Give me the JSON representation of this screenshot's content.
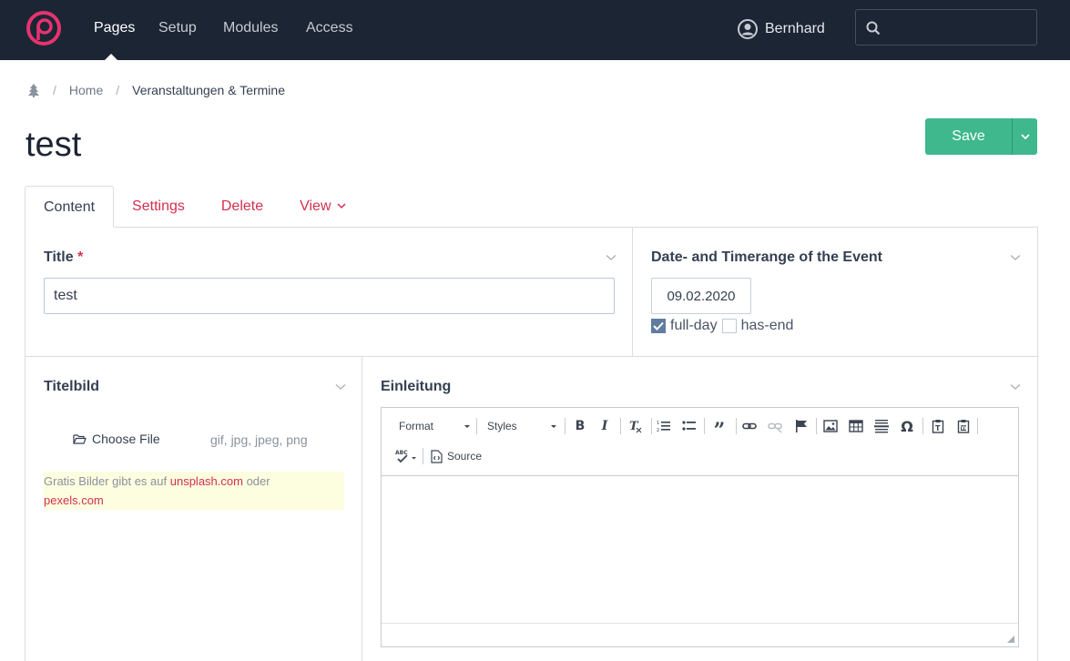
{
  "nav": {
    "items": [
      {
        "label": "Pages",
        "active": true
      },
      {
        "label": "Setup",
        "active": false
      },
      {
        "label": "Modules",
        "active": false
      },
      {
        "label": "Access",
        "active": false
      }
    ],
    "user": "Bernhard",
    "search_value": "",
    "logo_color": "#e6336f"
  },
  "breadcrumb": {
    "home": "Home",
    "current": "Veranstaltungen & Termine"
  },
  "page_title": "test",
  "save_label": "Save",
  "tabs": [
    {
      "label": "Content",
      "active": true
    },
    {
      "label": "Settings",
      "active": false
    },
    {
      "label": "Delete",
      "active": false
    },
    {
      "label": "View",
      "active": false
    }
  ],
  "fields": {
    "title": {
      "label": "Title",
      "required_mark": "*",
      "value": "test"
    },
    "date": {
      "label": "Date- and Timerange of the Event",
      "value": "09.02.2020",
      "full_day": {
        "label": "full-day",
        "checked": true
      },
      "has_end": {
        "label": "has-end",
        "checked": false
      }
    },
    "titelbild": {
      "label": "Titelbild",
      "choose_file": "Choose File",
      "file_types": "gif, jpg, jpeg, png",
      "hint_prefix": "Gratis Bilder gibt es auf ",
      "hint_link1": "unsplash.com",
      "hint_mid": " oder",
      "hint_link2": "pexels.com"
    },
    "einleitung": {
      "label": "Einleitung",
      "format": "Format",
      "styles": "Styles",
      "source": "Source",
      "content": ""
    }
  },
  "colors": {
    "navbar": "#1b2534",
    "accent": "#d2304f",
    "save": "#3fb88d"
  }
}
